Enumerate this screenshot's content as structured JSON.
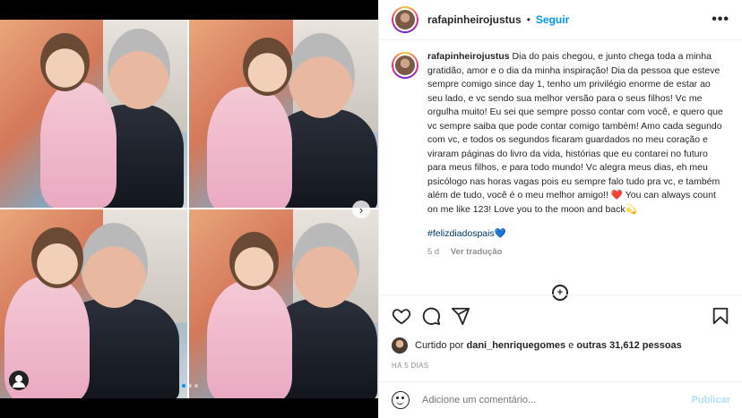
{
  "post": {
    "username": "rafapinheirojustus",
    "separator": "•",
    "follow_label": "Seguir",
    "more_glyph": "•••",
    "caption_text": "Dia do pais chegou, e junto chega toda a minha gratidão, amor e o dia da minha inspiração! Dia da pessoa que esteve sempre comigo since day 1, tenho um privilégio enorme de estar ao seu lado, e vc sendo sua melhor versão para o seus filhos! Vc me orgulha muito! Eu sei que sempre posso contar com você, e quero que vc sempre saiba que pode contar comigo também! Amo cada segundo com vc, e todos os segundos ficaram guardados no meu coração e viraram páginas do livro da vida, histórias que eu contarei no futuro para meus filhos, e para todo mundo! Vc alegra meus dias, eh meu psicólogo nas horas vagas pois eu sempre falo tudo pra vc, e também além de tudo, você é o meu melhor amigo!!",
    "caption_heart": "❤️",
    "caption_tail": "You can always count on me like 123! Love you to the moon and back💫",
    "hashtag": "#felizdiadospais💙",
    "age": "5 d",
    "translate_label": "Ver tradução",
    "liked_prefix": "Curtido por",
    "liked_user": "dani_henriquegomes",
    "liked_and": "e",
    "liked_others": "outras 31,612 pessoas",
    "time_ago": "HÁ 5 DIAS",
    "comment_placeholder": "Adicione um comentário...",
    "publish_label": "Publicar"
  },
  "media": {
    "carousel_total": 3,
    "carousel_index": 1,
    "next_glyph": "›"
  },
  "icons": [
    "heart-icon",
    "comment-icon",
    "share-icon",
    "bookmark-icon",
    "emoji-icon",
    "user-tag-icon",
    "more-icon",
    "load-more-icon"
  ],
  "colors": {
    "link": "#0095f6",
    "hashtag": "#00376b",
    "muted": "#8e8e8e",
    "publish_disabled": "#b2dffc"
  }
}
